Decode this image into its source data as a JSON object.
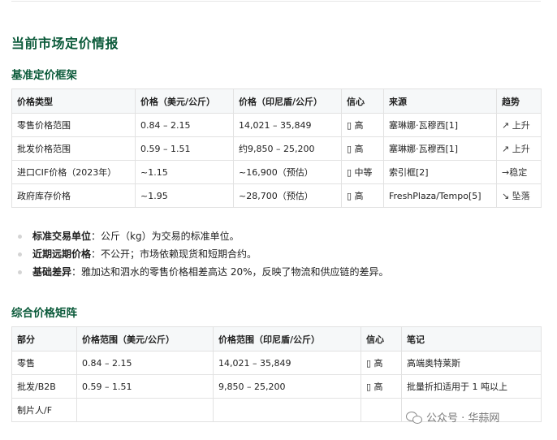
{
  "page_title": "当前市场定价情报",
  "section1": {
    "heading": "基准定价框架",
    "headers": [
      "价格类型",
      "价格（美元/公斤）",
      "价格（印尼盾/公斤）",
      "信心",
      "来源",
      "趋势"
    ],
    "rows": [
      [
        "零售价格范围",
        "0.84 – 2.15",
        "14,021 – 35,849",
        "▯ 高",
        "塞琳娜·瓦穆西[1]",
        "↗ 上升"
      ],
      [
        "批发价格范围",
        "0.59 – 1.51",
        "约9,850 – 25,200",
        "▯ 高",
        "塞琳娜·瓦穆西[1]",
        "↗ 上升"
      ],
      [
        "进口CIF价格（2023年）",
        "~1.15",
        "~16,900（预估）",
        "▯ 中等",
        "索引框[2]",
        "→稳定"
      ],
      [
        "政府库存价格",
        "~1.95",
        "~28,700（预估）",
        "▯ 高",
        "FreshPlaza/Tempo[5]",
        "↘ 坠落"
      ]
    ]
  },
  "notes": [
    {
      "label": "标准交易单位",
      "text": "：公斤（kg）为交易的标准单位。"
    },
    {
      "label": "近期远期价格",
      "text": "：不公开；市场依赖现货和短期合约。"
    },
    {
      "label": "基础差异",
      "text": "：雅加达和泗水的零售价格相差高达 20%，反映了物流和供应链的差异。"
    }
  ],
  "section2": {
    "heading": "综合价格矩阵",
    "headers": [
      "部分",
      "价格范围（美元/公斤）",
      "价格范围（印尼盾/公斤）",
      "信心",
      "笔记"
    ],
    "rows": [
      [
        "零售",
        "0.84 – 2.15",
        "14,021 – 35,849",
        "▯ 高",
        "高端奥特莱斯"
      ],
      [
        "批发/B2B",
        "0.59 – 1.51",
        "9,850 – 25,200",
        "▯ 高",
        "批量折扣适用于 1 吨以上"
      ],
      [
        "制片人/F",
        "",
        "",
        "",
        ""
      ]
    ]
  },
  "watermark": {
    "text": "公众号 · 华蒜网",
    "icon": "wechat-icon"
  }
}
